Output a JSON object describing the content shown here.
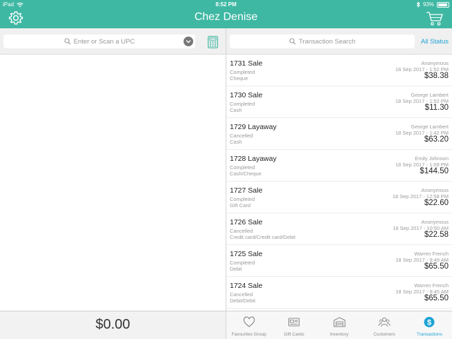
{
  "status_bar": {
    "device": "iPad",
    "time": "8:52 PM",
    "battery": "93%",
    "battery_level": 0.93
  },
  "header": {
    "title": "Chez Denise"
  },
  "left_panel": {
    "search_placeholder": "Enter or Scan a UPC",
    "total": "$0.00"
  },
  "right_panel": {
    "search_placeholder": "Transaction Search",
    "filter_label": "All Status"
  },
  "transactions": [
    {
      "title": "1731 Sale",
      "status": "Completed",
      "method": "Cheque",
      "customer": "Anonymous",
      "date": "18 Sep 2017 - 1:52 PM",
      "amount": "$38.38"
    },
    {
      "title": "1730 Sale",
      "status": "Completed",
      "method": "Cash",
      "customer": "George Lambert",
      "date": "18 Sep 2017 - 1:52 PM",
      "amount": "$11.30"
    },
    {
      "title": "1729 Layaway",
      "status": "Cancelled",
      "method": "Cash",
      "customer": "George Lambert",
      "date": "18 Sep 2017 - 1:42 PM",
      "amount": "$63.20"
    },
    {
      "title": "1728 Layaway",
      "status": "Completed",
      "method": "Cash/Cheque",
      "customer": "Emily Johnson",
      "date": "18 Sep 2017 - 1:09 PM",
      "amount": "$144.50"
    },
    {
      "title": "1727 Sale",
      "status": "Completed",
      "method": "Gift Card",
      "customer": "Anonymous",
      "date": "18 Sep 2017 - 12:58 PM",
      "amount": "$22.60"
    },
    {
      "title": "1726 Sale",
      "status": "Cancelled",
      "method": "Credit card/Credit card/Debit",
      "customer": "Anonymous",
      "date": "18 Sep 2017 - 10:50 AM",
      "amount": "$22.58"
    },
    {
      "title": "1725 Sale",
      "status": "Completed",
      "method": "Debit",
      "customer": "Warren French",
      "date": "18 Sep 2017 - 9:49 AM",
      "amount": "$65.50"
    },
    {
      "title": "1724 Sale",
      "status": "Cancelled",
      "method": "Debit/Debit",
      "customer": "Warren French",
      "date": "18 Sep 2017 - 9:45 AM",
      "amount": "$65.50"
    }
  ],
  "tabs": [
    {
      "label": "Favourites Group",
      "icon": "heart-icon",
      "active": false
    },
    {
      "label": "Gift Cards",
      "icon": "gift-card-icon",
      "active": false
    },
    {
      "label": "Inventory",
      "icon": "warehouse-icon",
      "active": false
    },
    {
      "label": "Customers",
      "icon": "customers-icon",
      "active": false
    },
    {
      "label": "Transactions",
      "icon": "dollar-icon",
      "active": true
    }
  ],
  "colors": {
    "brand": "#3fb8a3",
    "accent": "#1ea3d4",
    "muted": "#9a9a9a"
  }
}
